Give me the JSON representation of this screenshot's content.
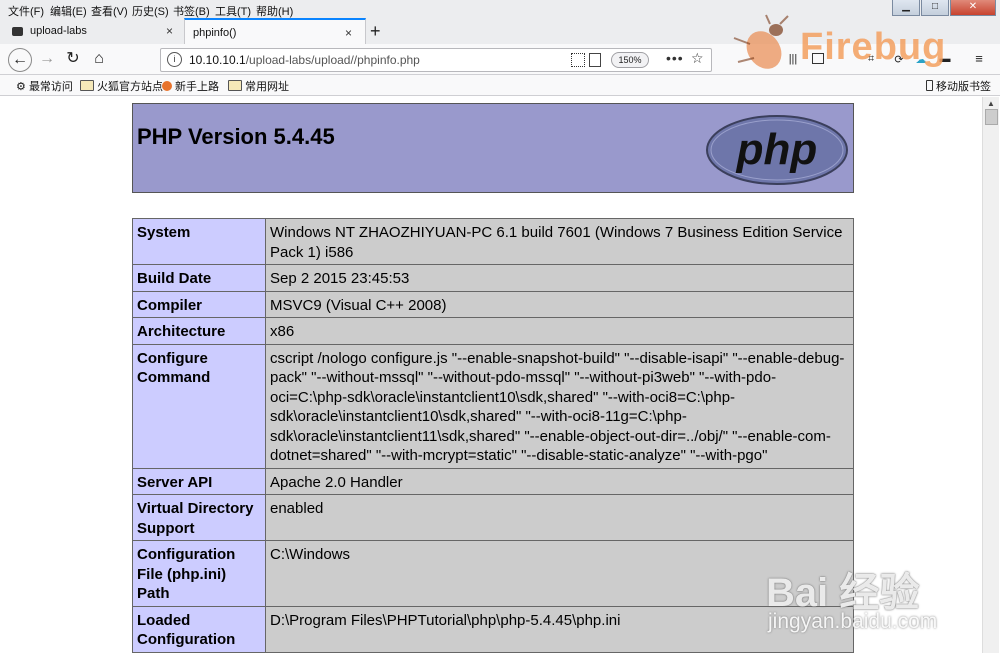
{
  "menu": [
    "文件(F)",
    "编辑(E)",
    "查看(V)",
    "历史(S)",
    "书签(B)",
    "工具(T)",
    "帮助(H)"
  ],
  "window_controls": {
    "minimize": "▁",
    "maximize": "□",
    "close": "✕"
  },
  "tabs": [
    {
      "title": "upload-labs",
      "close": "×"
    },
    {
      "title": "phpinfo()",
      "close": "×",
      "active": true
    }
  ],
  "new_tab": "+",
  "nav": {
    "back": "←",
    "forward": "→",
    "reload": "↻",
    "home": "⌂"
  },
  "url": {
    "host": "10.10.10.1",
    "path": "/upload-labs/upload//phpinfo.php"
  },
  "zoom": "150%",
  "page_actions": "•••",
  "bookmark_star": "☆",
  "bookmarks": [
    "最常访问",
    "火狐官方站点",
    "新手上路",
    "常用网址"
  ],
  "mobile_bookmarks": "移动版书签",
  "firebug_label": "Firebug",
  "php": {
    "version_title": "PHP Version 5.4.45",
    "logo_text": "php",
    "rows": [
      {
        "k": "System",
        "v": "Windows NT ZHAOZHIYUAN-PC 6.1 build 7601 (Windows 7 Business Edition Service Pack 1) i586"
      },
      {
        "k": "Build Date",
        "v": "Sep 2 2015 23:45:53"
      },
      {
        "k": "Compiler",
        "v": "MSVC9 (Visual C++ 2008)"
      },
      {
        "k": "Architecture",
        "v": "x86"
      },
      {
        "k": "Configure Command",
        "v": "cscript /nologo configure.js \"--enable-snapshot-build\" \"--disable-isapi\" \"--enable-debug-pack\" \"--without-mssql\" \"--without-pdo-mssql\" \"--without-pi3web\" \"--with-pdo-oci=C:\\php-sdk\\oracle\\instantclient10\\sdk,shared\" \"--with-oci8=C:\\php-sdk\\oracle\\instantclient10\\sdk,shared\" \"--with-oci8-11g=C:\\php-sdk\\oracle\\instantclient11\\sdk,shared\" \"--enable-object-out-dir=../obj/\" \"--enable-com-dotnet=shared\" \"--with-mcrypt=static\" \"--disable-static-analyze\" \"--with-pgo\""
      },
      {
        "k": "Server API",
        "v": "Apache 2.0 Handler"
      },
      {
        "k": "Virtual Directory Support",
        "v": "enabled"
      },
      {
        "k": "Configuration File (php.ini) Path",
        "v": "C:\\Windows"
      },
      {
        "k": "Loaded Configuration",
        "v": "D:\\Program Files\\PHPTutorial\\php\\php-5.4.45\\php.ini"
      }
    ]
  },
  "watermark": {
    "logo": "Bai 经验",
    "site": "jingyan.baidu.com"
  },
  "colors": {
    "header_bg": "#9999cc",
    "key_bg": "#ccccff",
    "value_bg": "#cccccc",
    "tab_accent": "#0a84ff"
  }
}
